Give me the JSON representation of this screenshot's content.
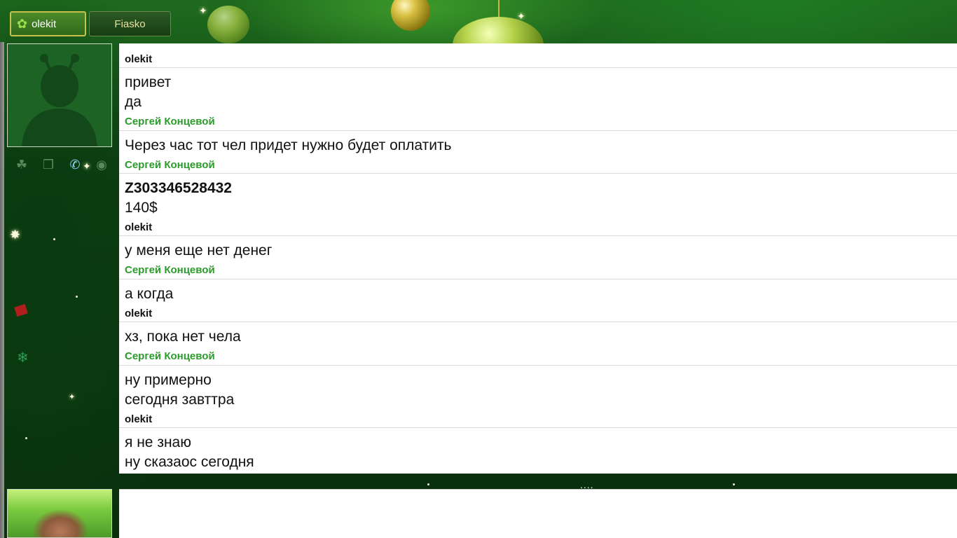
{
  "tabs": [
    {
      "label": "olekit",
      "active": true
    },
    {
      "label": "Fiasko",
      "active": false
    }
  ],
  "toolbar_icons": [
    "contacts-icon",
    "history-icon",
    "phone-icon",
    "webcam-icon"
  ],
  "messages": [
    {
      "sender": "olekit",
      "sender_type": "me",
      "lines": [
        "привет",
        "да"
      ]
    },
    {
      "sender": "Сергей Концевой",
      "sender_type": "other",
      "lines": [
        "Через час тот чел придет нужно будет оплатить"
      ]
    },
    {
      "sender": "Сергей Концевой",
      "sender_type": "other",
      "lines": [
        "Z303346528432",
        "140$"
      ]
    },
    {
      "sender": "olekit",
      "sender_type": "me",
      "lines": [
        "у меня еще нет денег"
      ]
    },
    {
      "sender": "Сергей Концевой",
      "sender_type": "other",
      "lines": [
        "а когда"
      ]
    },
    {
      "sender": "olekit",
      "sender_type": "me",
      "lines": [
        "хз, пока нет чела"
      ]
    },
    {
      "sender": "Сергей Концевой",
      "sender_type": "other",
      "lines": [
        "ну примерно",
        "сегодня завттра"
      ]
    },
    {
      "sender": "olekit",
      "sender_type": "me",
      "lines": [
        "я не знаю",
        "ну сказаос сегодня"
      ]
    }
  ],
  "splitter": "....",
  "colors": {
    "own_sender": "#111111",
    "contact_sender": "#2b9b2b",
    "theme_green": "#0d4012"
  }
}
